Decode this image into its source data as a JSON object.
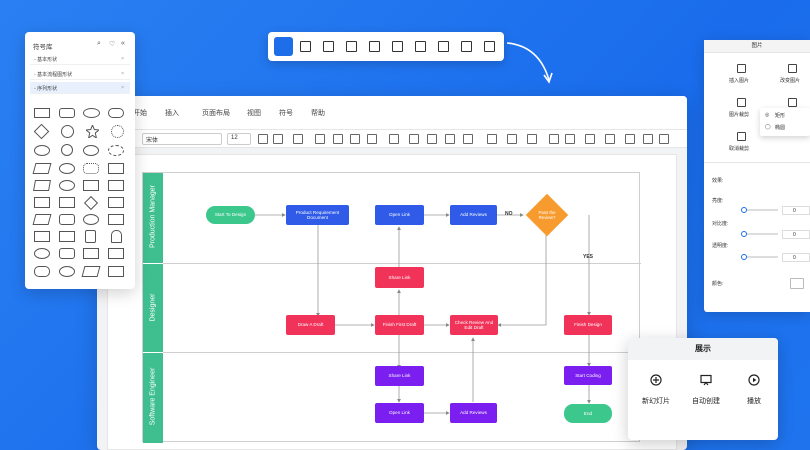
{
  "menu": [
    "开始",
    "插入",
    "页面布局",
    "视图",
    "符号",
    "帮助"
  ],
  "toolbar": {
    "font": "宋体",
    "size": "12"
  },
  "library": {
    "title": "符号库",
    "categories": [
      {
        "label": "◦ 基本形状"
      },
      {
        "label": "◦ 基本流程图形状"
      },
      {
        "label": "◦ 序列形状"
      }
    ]
  },
  "floatbar": {
    "icons": [
      "fill-icon",
      "grid-icon",
      "image-icon",
      "layers-icon",
      "page-icon",
      "chart-icon",
      "table-icon",
      "org-icon",
      "align-icon",
      "fullscreen-icon"
    ]
  },
  "lanes": [
    "Production Manager",
    "Designer",
    "Software Engineer"
  ],
  "nodes": {
    "start": "Start To Design",
    "product_req": "Product Requirement Document",
    "open_link_1": "Open Link",
    "add_reviews_1": "Add Reviews",
    "pass_review": "Pass the Review?",
    "share_link_1": "Share Link",
    "draw_draft": "Draw A Draft",
    "finish_first": "Finish First Draft",
    "check_review": "Check Review And Edit Draft",
    "finish_design": "Finish Design",
    "share_link_2": "Share Link",
    "open_link_2": "Open Link",
    "add_reviews_2": "Add Reviews",
    "start_coding": "Start Coding",
    "end": "End"
  },
  "edge_labels": {
    "no": "NO",
    "yes": "YES"
  },
  "image_panel": {
    "title": "图片",
    "insert": "插入图片",
    "replace": "改变图片",
    "crop": "图片裁剪",
    "reset": "取消裁剪",
    "opt1": "矩形",
    "opt2": "椭圆",
    "effects": "效果:",
    "brightness": "亮度:",
    "contrast": "对比度:",
    "transparency": "透明度:",
    "color": "颜色:",
    "brightness_val": "0",
    "contrast_val": "0",
    "transparency_val": "0"
  },
  "show_panel": {
    "title": "展示",
    "btn1": "新幻灯片",
    "btn2": "自动创建",
    "btn3": "播放"
  },
  "colors": {
    "accent": "#1e6eea",
    "lane": "#3fbf8f",
    "blue": "#2f5be8",
    "red": "#f1335a",
    "purple": "#7b1ef0",
    "orange": "#f79b2e"
  }
}
